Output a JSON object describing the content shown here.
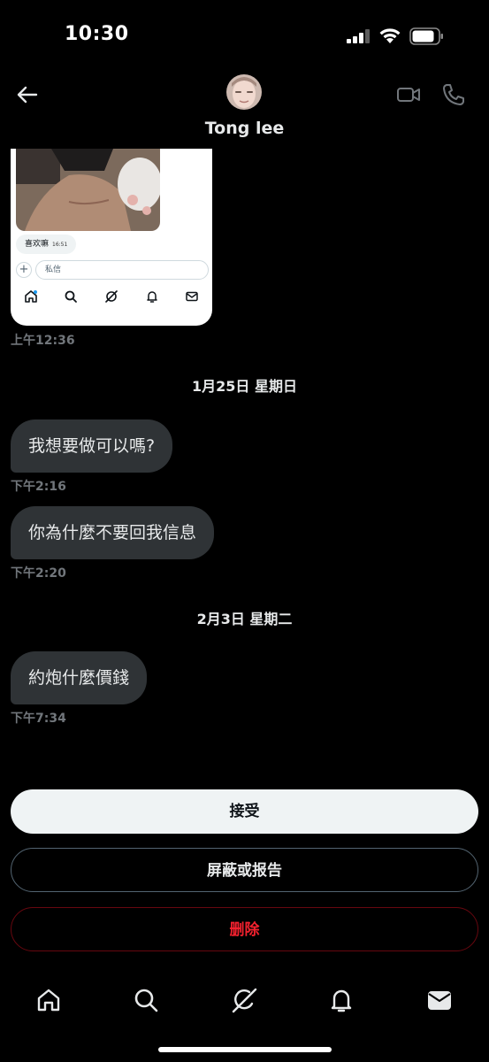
{
  "status_bar": {
    "time": "10:30"
  },
  "header": {
    "contact_name": "Tong lee",
    "icons": [
      "back-arrow-icon",
      "avatar",
      "video-icon",
      "phone-icon"
    ]
  },
  "shared_screenshot": {
    "bubble_text": "喜欢嘛",
    "bubble_time": "16:51",
    "input_placeholder": "私信",
    "plus_glyph": "+",
    "nav_icons": [
      "home-icon",
      "search-icon",
      "grok-icon",
      "bell-icon",
      "mail-icon"
    ]
  },
  "conversation": {
    "screenshot_time": "上午12:36",
    "groups": [
      {
        "date": "1月25日 星期日",
        "messages": [
          {
            "text": "我想要做可以嗎?",
            "time": "下午2:16"
          },
          {
            "text": "你為什麼不要回我信息",
            "time": "下午2:20"
          }
        ]
      },
      {
        "date": "2月3日 星期二",
        "messages": [
          {
            "text": "約炮什麼價錢",
            "time": "下午7:34"
          }
        ]
      }
    ]
  },
  "actions": {
    "accept": "接受",
    "block_report": "屏蔽或报告",
    "delete": "删除"
  },
  "tabbar": {
    "icons": [
      "home-icon",
      "search-icon",
      "grok-icon",
      "notifications-icon",
      "messages-icon"
    ],
    "active": "messages-icon"
  },
  "colors": {
    "background": "#000000",
    "bubble": "#2f3336",
    "secondary_text": "#71767b",
    "accept_button": "#eff3f4",
    "delete_red": "#f4212e"
  }
}
